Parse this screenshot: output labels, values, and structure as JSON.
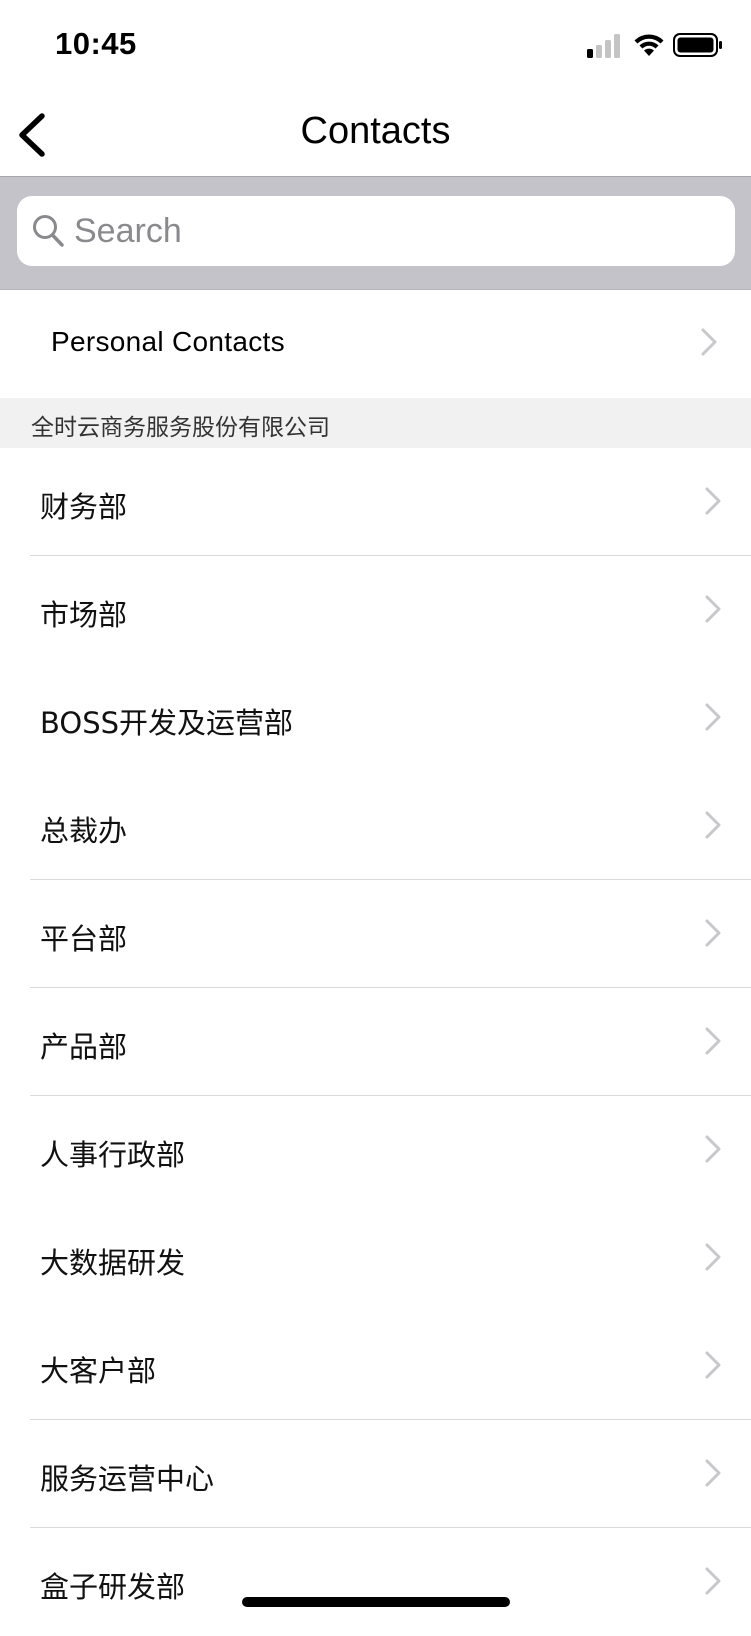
{
  "status_bar": {
    "time": "10:45"
  },
  "nav": {
    "title": "Contacts",
    "back_icon": "chevron-left-icon"
  },
  "search": {
    "placeholder": "Search",
    "value": ""
  },
  "personal_contacts": {
    "label": "Personal Contacts"
  },
  "section": {
    "company_name": "全时云商务服务股份有限公司"
  },
  "departments": [
    {
      "label": "财务部"
    },
    {
      "label": "市场部"
    },
    {
      "label": "BOSS开发及运营部"
    },
    {
      "label": "总裁办"
    },
    {
      "label": "平台部"
    },
    {
      "label": "产品部"
    },
    {
      "label": "人事行政部"
    },
    {
      "label": "大数据研发"
    },
    {
      "label": "大客户部"
    },
    {
      "label": "服务运营中心"
    },
    {
      "label": "盒子研发部"
    }
  ],
  "colors": {
    "search_bar_background": "#c3c3c9",
    "section_header_background": "#f1f1f1",
    "chevron": "#c7c7cc",
    "placeholder": "#8a8a8e"
  }
}
